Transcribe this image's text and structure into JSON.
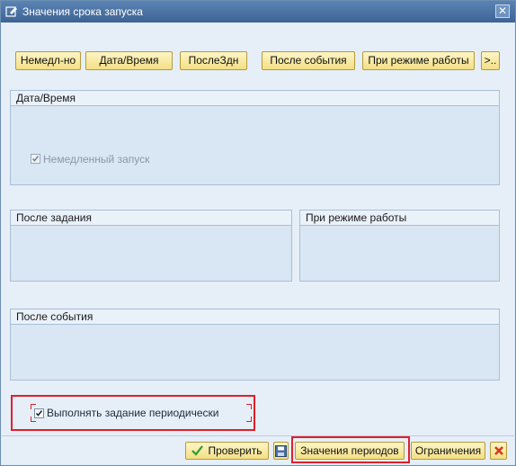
{
  "window": {
    "title": "Значения срока запуска",
    "close_symbol": "✕"
  },
  "toolbar": {
    "buttons": [
      {
        "label": "Немедл-но"
      },
      {
        "label": "Дата/Время"
      },
      {
        "label": "ПослеЗдн"
      },
      {
        "label": "После события"
      },
      {
        "label": "При режиме работы"
      },
      {
        "label": ">.."
      }
    ]
  },
  "groups": {
    "datetime": {
      "title": "Дата/Время",
      "immediate_label": "Немедленный запуск",
      "immediate_checked": true,
      "immediate_disabled": true
    },
    "after_job": {
      "title": "После задания"
    },
    "operation_mode": {
      "title": "При режиме работы"
    },
    "after_event": {
      "title": "После события"
    }
  },
  "periodic": {
    "label": "Выполнять задание периодически",
    "checked": true
  },
  "footer": {
    "check_label": "Проверить",
    "periods_label": "Значения периодов",
    "restrictions_label": "Ограничения"
  },
  "icons": {
    "title": "window-edit-icon",
    "check": "checkmark-icon",
    "save": "save-icon",
    "cancel": "cancel-icon"
  },
  "colors": {
    "highlight": "#e0202a",
    "titlebar": "#4a72a3",
    "button_face": "#f8e9a5"
  }
}
